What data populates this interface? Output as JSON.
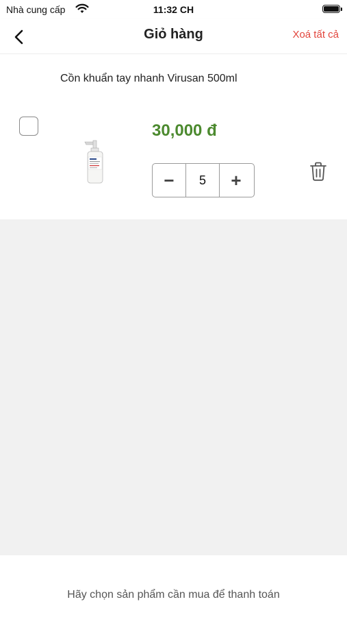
{
  "status_bar": {
    "carrier": "Nhà cung cấp",
    "time": "11:32 CH",
    "wifi_icon": "wifi-icon",
    "battery_icon": "battery-icon"
  },
  "header": {
    "back_icon": "chevron-left-icon",
    "title": "Giỏ hàng",
    "clear_all": "Xoá tất cả"
  },
  "cart": {
    "items": [
      {
        "name": "Cồn khuẩn tay nhanh Virusan 500ml",
        "price": "30,000 đ",
        "quantity": "5",
        "selected": false,
        "decrement_label": "−",
        "increment_label": "+",
        "delete_icon": "trash-icon"
      }
    ]
  },
  "footer": {
    "hint": "Hãy chọn sản phẩm cần mua để thanh toán"
  },
  "colors": {
    "price": "#4c8a2f",
    "clear_all": "#e2453c",
    "empty_background": "#f1f1f1"
  }
}
